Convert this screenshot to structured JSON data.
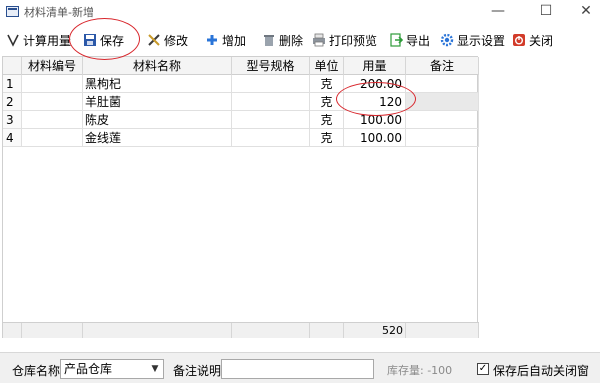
{
  "window": {
    "title": "材料清单-新增",
    "minimize": "—",
    "maximize": "☐",
    "close": "✕"
  },
  "toolbar": {
    "calc_label": "计算用量",
    "save_label": "保存",
    "edit_label": "修改",
    "add_label": "增加",
    "delete_label": "删除",
    "print_label": "打印预览",
    "export_label": "导出",
    "settings_label": "显示设置",
    "close_label": "关闭"
  },
  "grid": {
    "columns": [
      "",
      "材料编号",
      "材料名称",
      "型号规格",
      "单位",
      "用量",
      "备注"
    ],
    "rows": [
      {
        "num": "1",
        "code": "",
        "name": "黑枸杞",
        "spec": "",
        "unit": "克",
        "qty": "200.00",
        "remark": ""
      },
      {
        "num": "2",
        "code": "",
        "name": "羊肚菌",
        "spec": "",
        "unit": "克",
        "qty": "120",
        "remark": ""
      },
      {
        "num": "3",
        "code": "",
        "name": "陈皮",
        "spec": "",
        "unit": "克",
        "qty": "100.00",
        "remark": ""
      },
      {
        "num": "4",
        "code": "",
        "name": "金线莲",
        "spec": "",
        "unit": "克",
        "qty": "100.00",
        "remark": ""
      }
    ],
    "total_qty": "520"
  },
  "bottom": {
    "warehouse_label": "仓库名称",
    "warehouse_value": "产品仓库",
    "remark_label": "备注说明",
    "remark_value": "",
    "stock_text": "库存量: -100",
    "auto_close_label": "保存后自动关闭窗口",
    "auto_close_checked": true
  },
  "colors": {
    "annotation": "#d8262c",
    "save_icon": "#2b58a8",
    "add_icon": "#2a74d8",
    "close_icon": "#d23b2a",
    "export_icon": "#2e9b3a"
  }
}
